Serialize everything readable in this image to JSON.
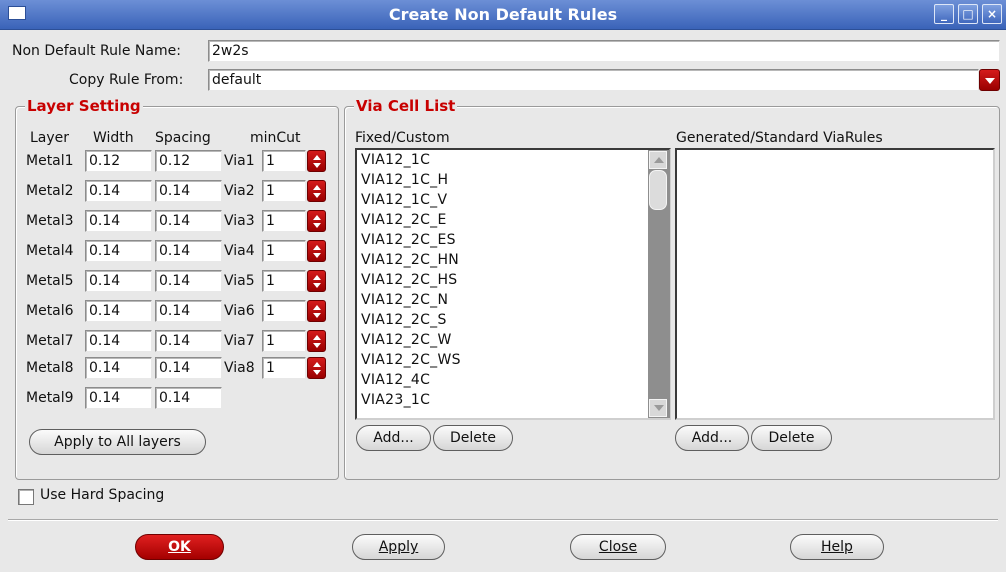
{
  "window": {
    "title": "Create Non Default Rules"
  },
  "form": {
    "rule_name_label": "Non Default Rule Name:",
    "rule_name_value": "2w2s",
    "copy_from_label": "Copy Rule From:",
    "copy_from_value": "default"
  },
  "layer_setting": {
    "title": "Layer Setting",
    "headers": {
      "layer": "Layer",
      "width": "Width",
      "spacing": "Spacing",
      "mincut": "minCut"
    },
    "rows": [
      {
        "layer": "Metal1",
        "width": "0.12",
        "spacing": "0.12",
        "via": "Via1",
        "mincut": "1"
      },
      {
        "layer": "Metal2",
        "width": "0.14",
        "spacing": "0.14",
        "via": "Via2",
        "mincut": "1"
      },
      {
        "layer": "Metal3",
        "width": "0.14",
        "spacing": "0.14",
        "via": "Via3",
        "mincut": "1"
      },
      {
        "layer": "Metal4",
        "width": "0.14",
        "spacing": "0.14",
        "via": "Via4",
        "mincut": "1"
      },
      {
        "layer": "Metal5",
        "width": "0.14",
        "spacing": "0.14",
        "via": "Via5",
        "mincut": "1"
      },
      {
        "layer": "Metal6",
        "width": "0.14",
        "spacing": "0.14",
        "via": "Via6",
        "mincut": "1"
      },
      {
        "layer": "Metal7",
        "width": "0.14",
        "spacing": "0.14",
        "via": "Via7",
        "mincut": "1"
      },
      {
        "layer": "Metal8",
        "width": "0.14",
        "spacing": "0.14",
        "via": "Via8",
        "mincut": "1"
      },
      {
        "layer": "Metal9",
        "width": "0.14",
        "spacing": "0.14"
      }
    ],
    "apply_all_label": "Apply to All layers"
  },
  "via_cell_list": {
    "title": "Via Cell List",
    "fixed": {
      "label": "Fixed/Custom",
      "items": [
        "VIA12_1C",
        "VIA12_1C_H",
        "VIA12_1C_V",
        "VIA12_2C_E",
        "VIA12_2C_ES",
        "VIA12_2C_HN",
        "VIA12_2C_HS",
        "VIA12_2C_N",
        "VIA12_2C_S",
        "VIA12_2C_W",
        "VIA12_2C_WS",
        "VIA12_4C",
        "VIA23_1C"
      ],
      "add_label": "Add...",
      "delete_label": "Delete"
    },
    "generated": {
      "label": "Generated/Standard ViaRules",
      "items": [],
      "add_label": "Add...",
      "delete_label": "Delete"
    }
  },
  "hard_spacing": {
    "label": "Use Hard Spacing",
    "checked": false
  },
  "buttons": {
    "ok": "OK",
    "apply": "Apply",
    "close": "Close",
    "help": "Help"
  },
  "colors": {
    "title_bar": "#3a63b8",
    "accent_red": "#c80000",
    "button_red": "#b30000"
  }
}
